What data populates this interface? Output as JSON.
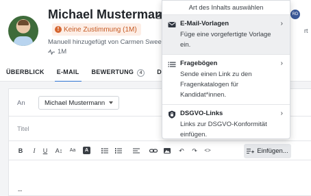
{
  "profile": {
    "name": "Michael Mustermann",
    "consent_badge": "Keine Zustimmung (1M)",
    "added_by": "Manuell hinzugefügt von Carmen Sweetw",
    "activity": "1M",
    "right_fragment": "rt",
    "initials": "RD"
  },
  "tabs": [
    {
      "label": "ÜBERBLICK"
    },
    {
      "label": "E-MAIL",
      "active": true
    },
    {
      "label": "BEWERTUNG",
      "count": "4"
    },
    {
      "label": "DATE"
    }
  ],
  "composer": {
    "to_label": "An",
    "recipient": "Michael Mustermann",
    "title_placeholder": "Titel",
    "toolbar": {
      "bold": "B",
      "italic": "I",
      "underline": "U",
      "font_size": "A↕",
      "case": "Aa",
      "highlight": "A",
      "insert_label": "Einfügen..."
    },
    "signature_separator": "--"
  },
  "dropdown": {
    "header": "Art des Inhalts auswählen",
    "items": [
      {
        "icon": "mail-icon",
        "title": "E-Mail-Vorlagen",
        "description": "Füge eine vorgefertigte Vorlage ein."
      },
      {
        "icon": "list-icon",
        "title": "Fragebögen",
        "description": "Sende einen Link zu den Fragenkatalogen für Kandidat*innen."
      },
      {
        "icon": "shield-lock-icon",
        "title": "DSGVO-Links",
        "description": "Links zur DSGVO-Konformität einfügen."
      }
    ]
  },
  "colors": {
    "accent": "#2c73d2",
    "consent_text": "#c65a23",
    "consent_bg": "#fdeee6"
  }
}
